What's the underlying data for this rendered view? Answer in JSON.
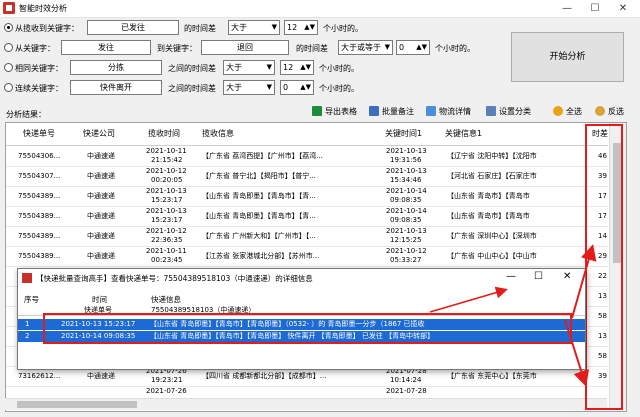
{
  "window": {
    "title": "智能时效分析",
    "min": "—",
    "max": "☐",
    "close": "✕"
  },
  "conditions": [
    {
      "label": "从揽收到关键字：",
      "value": "已发往",
      "diff_label": "的时间差",
      "op": "大于",
      "num": "12",
      "unit": "个小时的。",
      "checked": true
    },
    {
      "label": "从关键字：",
      "value": "发往",
      "to_label": "到关键字：",
      "to_value": "退回",
      "diff_label": "的时间差",
      "op": "大于或等于",
      "num": "0",
      "unit": "个小时的。",
      "checked": false
    },
    {
      "label": "相同关键字：",
      "value": "分拣",
      "diff_label": "之间的时间差",
      "op": "大于",
      "num": "12",
      "unit": "个小时的。",
      "checked": false
    },
    {
      "label": "连续关键字：",
      "value": "快件离开",
      "diff_label": "之间的时间差",
      "op": "大于",
      "num": "0",
      "unit": "个小时的。",
      "checked": false
    }
  ],
  "start_button": "开始分析",
  "results_label": "分析结果：",
  "toolbar": [
    "导出表格",
    "批量备注",
    "物流详情",
    "设置分类",
    "全选",
    "反选"
  ],
  "table": {
    "headers": [
      "快递单号",
      "快递公司",
      "揽收时间",
      "揽收信息",
      "关键时间1",
      "关键信息1",
      "时差1"
    ],
    "rows": [
      {
        "no": "75504306...",
        "co": "中通速递",
        "t1": "2021-10-11",
        "t2": "21:15:42",
        "info": "【广东省 荔湾西提】【广州市】【荔湾...",
        "k1": "2021-10-13",
        "k2": "19:31:56",
        "kinfo": "【辽宁省 沈阳中转】【沈阳市",
        "d": "46"
      },
      {
        "no": "75504307...",
        "co": "中通速递",
        "t1": "2021-10-12",
        "t2": "00:20:05",
        "info": "【广东省 普宁北】【揭阳市】【普宁...",
        "k1": "2021-10-13",
        "k2": "15:34:46",
        "kinfo": "【河北省 石家庄】【石家庄市",
        "d": "39"
      },
      {
        "no": "75504389...",
        "co": "中通速递",
        "t1": "2021-10-13",
        "t2": "15:23:17",
        "info": "【山东省 青岛即墨】【青岛市】【青...",
        "k1": "2021-10-14",
        "k2": "09:08:35",
        "kinfo": "【山东省 青岛市】【青岛市",
        "d": "17"
      },
      {
        "no": "75504389...",
        "co": "中通速递",
        "t1": "2021-10-13",
        "t2": "15:23:17",
        "info": "【山东省 青岛即墨】【青岛市】【青...",
        "k1": "2021-10-14",
        "k2": "09:08:35",
        "kinfo": "【山东省 青岛市】【青岛市",
        "d": "17"
      },
      {
        "no": "75504389...",
        "co": "中通速递",
        "t1": "2021-10-12",
        "t2": "22:36:35",
        "info": "【广东省 广州新大和】【广州市】【...",
        "k1": "2021-10-13",
        "k2": "12:15:25",
        "kinfo": "【广东省 深圳中心】【深圳市",
        "d": "14"
      },
      {
        "no": "75504389...",
        "co": "中通速递",
        "t1": "2021-10-11",
        "t2": "00:23:45",
        "info": "【江苏省 张家港城北分部】【苏州市...",
        "k1": "2021-10-12",
        "k2": "05:33:27",
        "kinfo": "【广东省 中山中心】【中山市",
        "d": "29"
      },
      {
        "no": "",
        "co": "",
        "t1": "",
        "t2": "",
        "info": "",
        "k1": "",
        "k2": "",
        "kinfo": "",
        "d": "22"
      },
      {
        "no": "",
        "co": "",
        "t1": "",
        "t2": "",
        "info": "",
        "k1": "",
        "k2": "",
        "kinfo": "",
        "d": "13"
      },
      {
        "no": "",
        "co": "",
        "t1": "",
        "t2": "",
        "info": "",
        "k1": "",
        "k2": "",
        "kinfo": "",
        "d": "58"
      },
      {
        "no": "",
        "co": "",
        "t1": "",
        "t2": "",
        "info": "",
        "k1": "",
        "k2": "",
        "kinfo": "",
        "d": "13"
      },
      {
        "no": "",
        "co": "",
        "t1": "",
        "t2": "",
        "info": "",
        "k1": "",
        "k2": "",
        "kinfo": "",
        "d": "58"
      },
      {
        "no": "73162612...",
        "co": "中通速递",
        "t1": "2021-07-26",
        "t2": "19:23:21",
        "info": "【四川省 成都新都北分部】【成都市】...",
        "k1": "2021-07-28",
        "k2": "10:14:24",
        "kinfo": "【广东省 东莞中心】【东莞市",
        "d": "39"
      },
      {
        "no": "",
        "co": "",
        "t1": "2021-07-26",
        "t2": "",
        "info": "",
        "k1": "2021-07-28",
        "k2": "",
        "kinfo": "",
        "d": ""
      }
    ]
  },
  "popup": {
    "title": "【快递批量查询高手】查看快递单号：75504389518103（中通速递）的详细信息",
    "headers": [
      "序号",
      "时间",
      "快递信息"
    ],
    "sub_time": "快递单号",
    "sub_info": "75504389518103（中通速递）",
    "rows": [
      {
        "idx": "1",
        "time": "2021-10-13 15:23:17",
        "info": "【山东省 青岛即墨】【青岛市】【青岛即墨】（0532-       ）的 青岛即墨一分步（1867           已揽收"
      },
      {
        "idx": "2",
        "time": "2021-10-14 09:08:35",
        "info": "【山东省 青岛即墨】【青岛市】【青岛即墨】 快件离开 【青岛即墨】 已发往 【青岛中转部】"
      }
    ],
    "min": "—",
    "max": "☐",
    "close": "✕"
  }
}
